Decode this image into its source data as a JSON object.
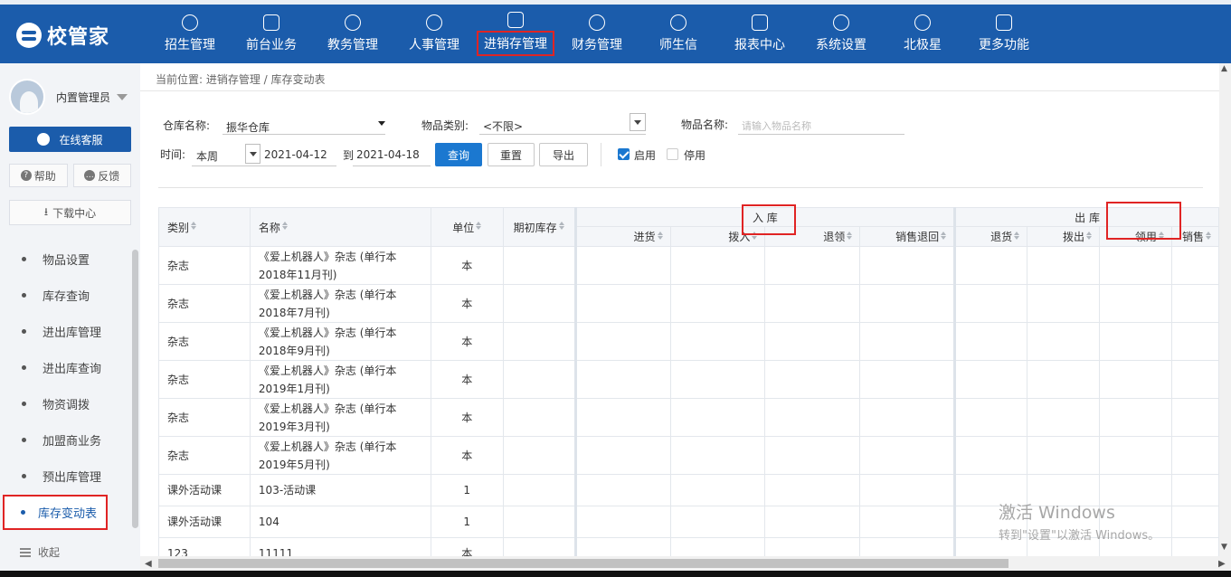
{
  "app": {
    "logo_text": "校管家"
  },
  "nav": [
    {
      "label": "招生管理",
      "icon": "person-plus-icon"
    },
    {
      "label": "前台业务",
      "icon": "monitor-icon"
    },
    {
      "label": "教务管理",
      "icon": "book-icon"
    },
    {
      "label": "人事管理",
      "icon": "user-icon"
    },
    {
      "label": "进销存管理",
      "icon": "inventory-icon",
      "active": true
    },
    {
      "label": "财务管理",
      "icon": "yen-icon"
    },
    {
      "label": "师生信",
      "icon": "chat-icon"
    },
    {
      "label": "报表中心",
      "icon": "chart-icon"
    },
    {
      "label": "系统设置",
      "icon": "gear-icon"
    },
    {
      "label": "北极星",
      "icon": "star-icon"
    },
    {
      "label": "更多功能",
      "icon": "more-icon"
    }
  ],
  "sidebar": {
    "user_name": "内置管理员",
    "service_label": "在线客服",
    "help_label": "帮助",
    "feedback_label": "反馈",
    "download_label": "下载中心",
    "items": [
      {
        "label": "物品设置"
      },
      {
        "label": "库存查询"
      },
      {
        "label": "进出库管理"
      },
      {
        "label": "进出库查询"
      },
      {
        "label": "物资调拨"
      },
      {
        "label": "加盟商业务"
      },
      {
        "label": "预出库管理"
      },
      {
        "label": "库存变动表",
        "active": true
      }
    ],
    "collapse_label": "收起"
  },
  "breadcrumb": "当前位置: 进销存管理 / 库存变动表",
  "filters": {
    "warehouse_label": "仓库名称:",
    "warehouse_value": "振华仓库",
    "category_label": "物品类别:",
    "category_value": "<不限>",
    "item_name_label": "物品名称:",
    "item_name_placeholder": "请输入物品名称",
    "time_label": "时间:",
    "period_value": "本周",
    "date_from": "2021-04-12",
    "to_label": "到",
    "date_to": "2021-04-18",
    "query_btn": "查询",
    "reset_btn": "重置",
    "export_btn": "导出",
    "enabled_label": "启用",
    "enabled_checked": true,
    "disabled_label": "停用",
    "disabled_checked": false
  },
  "table": {
    "headers": {
      "category": "类别",
      "name": "名称",
      "unit": "单位",
      "opening": "期初库存"
    },
    "in_group": "入 库",
    "in_cols": [
      "进货",
      "拨入",
      "退领",
      "销售退回"
    ],
    "out_group": "出 库",
    "out_cols": [
      "退货",
      "拨出",
      "领用",
      "销售"
    ],
    "rows": [
      {
        "category": "杂志",
        "name": "《爱上机器人》杂志 (单行本2018年11月刊)",
        "unit": "本"
      },
      {
        "category": "杂志",
        "name": "《爱上机器人》杂志 (单行本2018年7月刊)",
        "unit": "本"
      },
      {
        "category": "杂志",
        "name": "《爱上机器人》杂志 (单行本2018年9月刊)",
        "unit": "本"
      },
      {
        "category": "杂志",
        "name": "《爱上机器人》杂志 (单行本2019年1月刊)",
        "unit": "本"
      },
      {
        "category": "杂志",
        "name": "《爱上机器人》杂志 (单行本2019年3月刊)",
        "unit": "本"
      },
      {
        "category": "杂志",
        "name": "《爱上机器人》杂志 (单行本2019年5月刊)",
        "unit": "本"
      },
      {
        "category": "课外活动课",
        "name": "103-活动课",
        "unit": "1"
      },
      {
        "category": "课外活动课",
        "name": "104",
        "unit": "1"
      },
      {
        "category": "123",
        "name": "11111",
        "unit": "本"
      }
    ]
  },
  "watermark": {
    "line1": "激活 Windows",
    "line2": "转到\"设置\"以激活 Windows。"
  },
  "colors": {
    "brand": "#1b5cab",
    "primary_button": "#1b78d0",
    "highlight": "#e02424"
  }
}
